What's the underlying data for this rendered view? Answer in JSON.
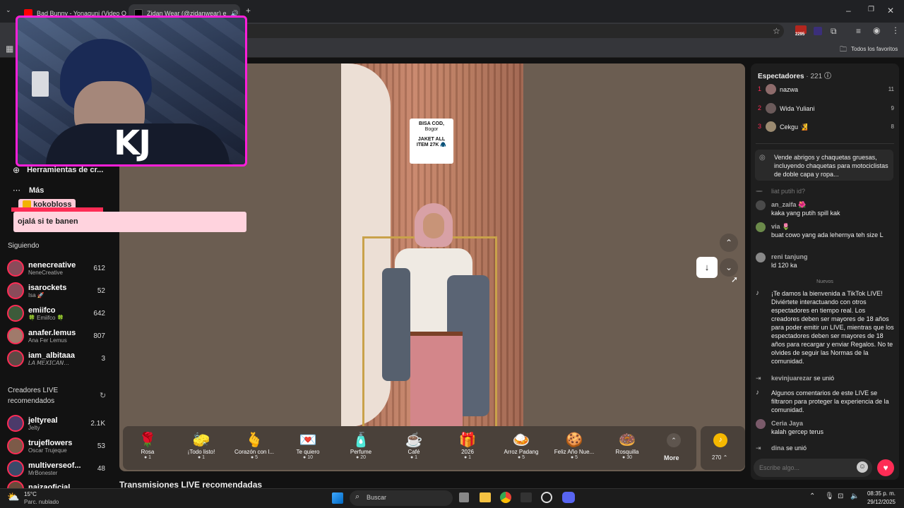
{
  "tabs": [
    {
      "label": "Bad Bunny - Yonaguni (Video O"
    },
    {
      "label": "Zidan Wear (@zidanwear) e"
    }
  ],
  "bookmarks": {
    "all": "Todos los favoritos"
  },
  "toolbar": {
    "badge": "2295"
  },
  "sidebar": {
    "tools": "Herramientas de cr...",
    "more": "Más",
    "following_title": "Siguiendo",
    "following": [
      {
        "name": "nenecreative",
        "sub": "NeneCreative",
        "count": "612"
      },
      {
        "name": "isarockets",
        "sub": "Isa 🚀",
        "count": "52"
      },
      {
        "name": "emiifco",
        "sub": "🍀 Emiifco 🍀",
        "count": "642"
      },
      {
        "name": "anafer.lemus",
        "sub": "Ana Fer Lemus",
        "count": "807"
      },
      {
        "name": "iam_albitaaa",
        "sub": "𝘓𝘈 𝘔𝘌𝘟𝘐𝘊𝘈𝘕…",
        "count": "3"
      }
    ],
    "recommended_title": "Creadores LIVE recomendados",
    "recommended": [
      {
        "name": "jeltyreal",
        "sub": "Jelty",
        "count": "2.1K"
      },
      {
        "name": "trujeflowers",
        "sub": "Oscar Trujeque",
        "count": "53"
      },
      {
        "name": "multiverseof...",
        "sub": "MrBonester",
        "count": "48"
      },
      {
        "name": "naizaoficial",
        "sub": "",
        "count": ""
      }
    ]
  },
  "overlay": {
    "alert_user": "kokobloss",
    "alert_msg": "ojalá si te banen",
    "cam_text": "KJ"
  },
  "video": {
    "sign_line1": "BISA COD,",
    "sign_line2": "Bogor",
    "sign_line3": "JAKET ALL",
    "sign_line4": "ITEM 27K 🧥"
  },
  "gifts": [
    {
      "name": "Rosa",
      "price": "1",
      "icon": "🌹"
    },
    {
      "name": "¡Todo listo!",
      "price": "1",
      "icon": "🧽"
    },
    {
      "name": "Corazón con l...",
      "price": "5",
      "icon": "🫰"
    },
    {
      "name": "Te quiero",
      "price": "10",
      "icon": "💌"
    },
    {
      "name": "Perfume",
      "price": "20",
      "icon": "🧴"
    },
    {
      "name": "Café",
      "price": "1",
      "icon": "☕"
    },
    {
      "name": "2026",
      "price": "1",
      "icon": "🎁"
    },
    {
      "name": "Arroz Padang",
      "price": "5",
      "icon": "🍛"
    },
    {
      "name": "Feliz Año Nue...",
      "price": "5",
      "icon": "🍪"
    },
    {
      "name": "Rosquilla",
      "price": "30",
      "icon": "🍩"
    }
  ],
  "gift_more": "More",
  "coins": "270",
  "recommended_streams": "Transmisiones LIVE recomendadas",
  "viewers": {
    "title": "Espectadores",
    "count": "· 221",
    "top": [
      {
        "rank": "1",
        "name": "nazwa",
        "score": "11"
      },
      {
        "rank": "2",
        "name": "Wida Yuliani",
        "score": "9"
      },
      {
        "rank": "3",
        "name": "Cekgu 🧏",
        "score": "8"
      }
    ]
  },
  "chat": {
    "pinned": "Vende abrigos y chaquetas gruesas, incluyendo chaquetas para motociclistas de doble capa y ropa...",
    "faded": "liat putih id?",
    "c1_user": "an_zaifa 🌺",
    "c1_text": "kaka yang putih spill kak",
    "c2_user": "via 🌷",
    "c2_text": "buat cowo yang ada lehernya teh size L",
    "c3_user": "reni tanjung",
    "c3_text": "ld 120 ka",
    "divider": "Nuevos",
    "welcome": "¡Te damos la bienvenida a TikTok LIVE! Diviértete interactuando con otros espectadores en tiempo real. Los creadores deben ser mayores de 18 años para poder emitir un LIVE, mientras que los espectadores deben ser mayores de 18 años para recargar y enviar Regalos. No te olvides de seguir las Normas de la comunidad.",
    "join1_user": "kevinjuarezar",
    "join1_text": "se unió",
    "filter": "Algunos comentarios de este LIVE se filtraron para proteger la experiencia de la comunidad.",
    "c4_user": "Ceria Jaya",
    "c4_text": "kalah gercep terus",
    "join2_user": "dina",
    "join2_text": "se unió",
    "input_placeholder": "Escribe algo..."
  },
  "taskbar": {
    "temp": "15°C",
    "weather": "Parc. nublado",
    "search": "Buscar",
    "time": "08:35 p. m.",
    "date": "29/12/2025"
  }
}
